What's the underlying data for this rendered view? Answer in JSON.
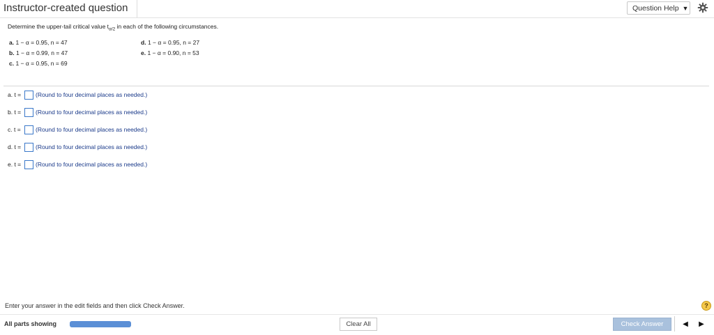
{
  "header": {
    "title": "Instructor-created question",
    "question_help_label": "Question Help",
    "dropdown_glyph": "▼",
    "settings_icon": "gear-icon"
  },
  "problem": {
    "prompt_before": "Determine the upper-tail critical value t",
    "prompt_sub": "α/2",
    "prompt_after": " in each of the following circumstances.",
    "conditions": [
      {
        "letter": "a.",
        "text": "1 − α = 0.95, n = 47"
      },
      {
        "letter": "b.",
        "text": "1 − α = 0.99, n = 47"
      },
      {
        "letter": "c.",
        "text": "1 − α = 0.95, n = 69"
      },
      {
        "letter": "d.",
        "text": "1 − α = 0.95, n = 27"
      },
      {
        "letter": "e.",
        "text": "1 − α = 0.90, n = 53"
      }
    ]
  },
  "answers": [
    {
      "label": "a. t =",
      "value": "",
      "hint": "(Round to four decimal places as needed.)"
    },
    {
      "label": "b. t =",
      "value": "",
      "hint": "(Round to four decimal places as needed.)"
    },
    {
      "label": "c. t =",
      "value": "",
      "hint": "(Round to four decimal places as needed.)"
    },
    {
      "label": "d. t =",
      "value": "",
      "hint": "(Round to four decimal places as needed.)"
    },
    {
      "label": "e. t =",
      "value": "",
      "hint": "(Round to four decimal places as needed.)"
    }
  ],
  "footer": {
    "instructions": "Enter your answer in the edit fields and then click Check Answer.",
    "help_glyph": "?",
    "parts_label": "All parts showing",
    "progress_fraction": 1.0,
    "clear_all_label": "Clear All",
    "check_answer_label": "Check Answer",
    "prev_glyph": "◀",
    "next_glyph": "▶"
  },
  "colors": {
    "accent": "#5b8fd6",
    "hint_text": "#1a3a8a",
    "check_button": "#a9c1dd"
  }
}
